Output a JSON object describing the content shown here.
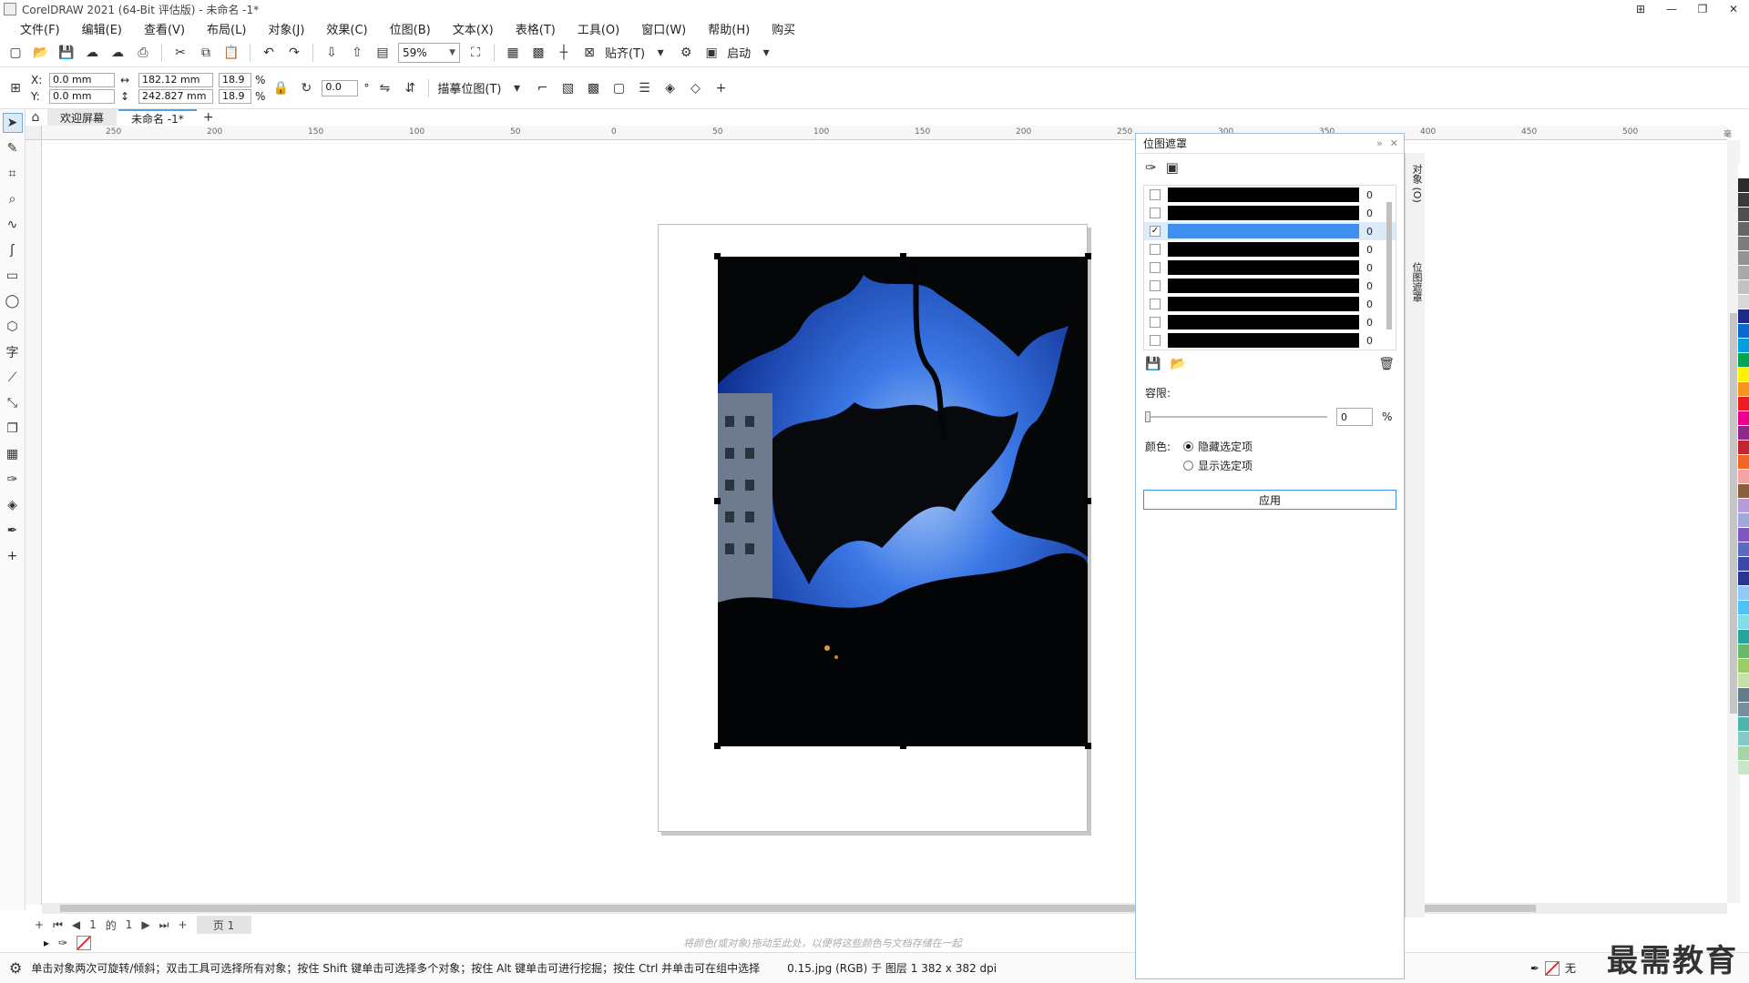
{
  "window": {
    "title": "CorelDRAW 2021 (64-Bit 评估版) - 未命名 -1*",
    "controls": [
      "⊞",
      "—",
      "❐",
      "✕"
    ]
  },
  "menu": [
    "文件(F)",
    "编辑(E)",
    "查看(V)",
    "布局(L)",
    "对象(J)",
    "效果(C)",
    "位图(B)",
    "文本(X)",
    "表格(T)",
    "工具(O)",
    "窗口(W)",
    "帮助(H)",
    "购买"
  ],
  "toolbar": {
    "zoom": "59%",
    "snap_label": "贴齐(T)",
    "launch_label": "启动"
  },
  "properties": {
    "x_label": "X:",
    "y_label": "Y:",
    "x": "0.0 mm",
    "y": "0.0 mm",
    "width": "182.12 mm",
    "height": "242.827 mm",
    "scale_x": "18.9",
    "scale_y": "18.9",
    "pct": "%",
    "rotation": "0.0",
    "degree": "°",
    "trace_label": "描摹位图(T)"
  },
  "tabs": {
    "welcome": "欢迎屏幕",
    "doc": "未命名 -1*"
  },
  "ruler": {
    "ticks": [
      "250",
      "200",
      "150",
      "100",
      "50",
      "0",
      "50",
      "100",
      "150",
      "200",
      "250",
      "300",
      "350",
      "400",
      "450",
      "500",
      "毫米"
    ]
  },
  "pagenav": {
    "current": "1",
    "of": "的",
    "total": "1",
    "page_tab": "页 1"
  },
  "colorbar": {
    "hint": "将颜色(或对象)拖动至此处，以便将这些颜色与文档存储在一起"
  },
  "status": {
    "hint": "单击对象两次可旋转/倾斜；双击工具可选择所有对象；按住 Shift 键单击可选择多个对象；按住 Alt 键单击可进行挖掘；按住 Ctrl 并单击可在组中选择",
    "object": "0.15.jpg (RGB) 于 图层 1 382 x 382 dpi",
    "fill": "无"
  },
  "watermark": "最需教育",
  "docker_tabs": {
    "objects": "对象 (O)",
    "mask": "位图遮罩"
  },
  "mask_panel": {
    "title": "位图遮罩",
    "rows": [
      {
        "checked": false,
        "selected": false,
        "value": "0"
      },
      {
        "checked": false,
        "selected": false,
        "value": "0"
      },
      {
        "checked": true,
        "selected": true,
        "value": "0"
      },
      {
        "checked": false,
        "selected": false,
        "value": "0"
      },
      {
        "checked": false,
        "selected": false,
        "value": "0"
      },
      {
        "checked": false,
        "selected": false,
        "value": "0"
      },
      {
        "checked": false,
        "selected": false,
        "value": "0"
      },
      {
        "checked": false,
        "selected": false,
        "value": "0"
      },
      {
        "checked": false,
        "selected": false,
        "value": "0"
      }
    ],
    "tolerance_label": "容限:",
    "tolerance_value": "0",
    "tolerance_pct": "%",
    "tolerance_fraction": 0,
    "color_label": "颜色:",
    "radio_hide": "隐藏选定项",
    "radio_show": "显示选定项",
    "radio_selected": "hide",
    "apply": "应用"
  },
  "palette": [
    "#ffffff",
    "#2b2b2b",
    "#3a3a3a",
    "#4f4f4f",
    "#666666",
    "#7d7d7d",
    "#939393",
    "#aaaaaa",
    "#c2c2c2",
    "#d8d8d8",
    "#1e2a8c",
    "#0a6ad4",
    "#00a0e0",
    "#00a651",
    "#fff200",
    "#f7941d",
    "#ed1c24",
    "#ec008c",
    "#92278f",
    "#c1272d",
    "#f26522",
    "#f5a3a3",
    "#8b5e3c",
    "#b39ddb",
    "#9fa8da",
    "#7e57c2",
    "#5c6bc0",
    "#3949ab",
    "#283593",
    "#90caf9",
    "#4fc3f7",
    "#80deea",
    "#26a69a",
    "#66bb6a",
    "#9ccc65",
    "#c5e1a5",
    "#607d8b",
    "#78909c",
    "#4db6ac",
    "#80cbc4",
    "#a5d6a7",
    "#c8e6c9"
  ]
}
